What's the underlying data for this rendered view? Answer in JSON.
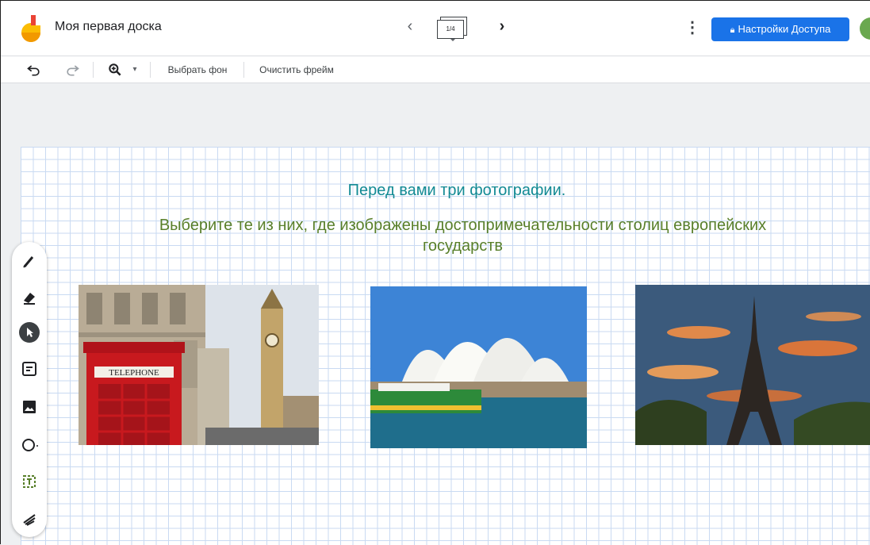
{
  "header": {
    "title": "Моя первая доска",
    "frame_counter": "1/4",
    "share_label": "Настройки Доступа"
  },
  "toolbar": {
    "choose_background": "Выбрать фон",
    "clear_frame": "Очистить фрейм"
  },
  "board": {
    "heading_line1": "Перед вами три фотографии.",
    "heading_line2": "Выберите те из них, где изображены достопримечательности столиц европейских государств"
  },
  "images": [
    {
      "name": "london-photo",
      "label": "TELEPHONE"
    },
    {
      "name": "sydney-opera-photo"
    },
    {
      "name": "eiffel-tower-photo"
    }
  ],
  "colors": {
    "accent": "#1a73e8",
    "heading1": "#128a94",
    "heading2": "#587f2a",
    "grid": "#c9daf2"
  },
  "icons": [
    "jamboard-logo-icon",
    "chevron-left-icon",
    "chevron-right-icon",
    "more-vert-icon",
    "lock-icon",
    "undo-icon",
    "redo-icon",
    "zoom-icon",
    "pen-icon",
    "eraser-icon",
    "select-icon",
    "sticky-note-icon",
    "image-icon",
    "circle-icon",
    "text-box-icon",
    "laser-icon"
  ]
}
